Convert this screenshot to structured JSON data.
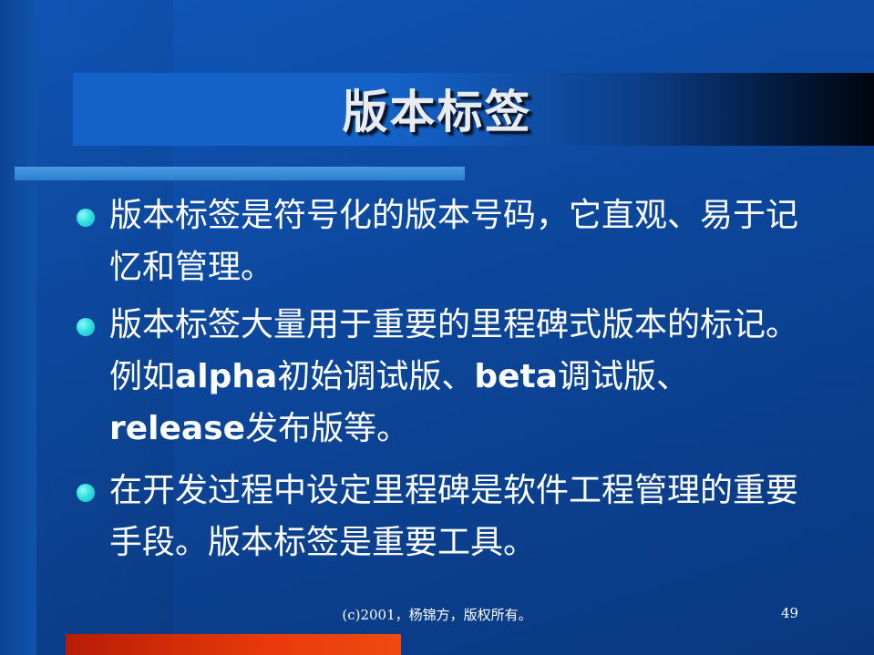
{
  "slide": {
    "title": "版本标签",
    "bullets": [
      {
        "parts": [
          "版本标签是符号化的版本号码，它直观、易于记忆和管理。"
        ]
      },
      {
        "parts": [
          "版本标签大量用于重要的里程碑式版本的标记。例如",
          "alpha",
          "初始调试版、",
          "beta",
          "调试版、",
          "release",
          "发布版等。"
        ]
      },
      {
        "parts": [
          "在开发过程中设定里程碑是软件工程管理的重要手段。版本标签是重要工具。"
        ]
      }
    ],
    "footer": "(c)2001，杨锦方，版权所有。",
    "page_number": "49",
    "colors": {
      "background": "#0f4ea6",
      "bullet_dot": "#33e0e0",
      "rule": "#3a8de0",
      "accent_bar": "#e83a0a",
      "text": "#ffffff"
    }
  }
}
